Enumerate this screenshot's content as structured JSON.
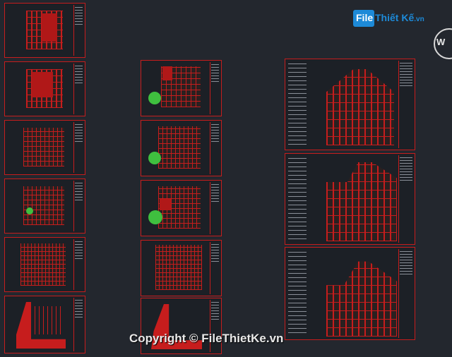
{
  "logo": {
    "part1": "File",
    "part2": "Thiết Kế",
    "suffix": ".vn"
  },
  "compass_letter": "W",
  "copyright": "Copyright © FileThietKe.vn",
  "colors": {
    "background": "#23272e",
    "frame": "#c61d1d",
    "accent": "#1d8ad8",
    "tree": "#3fbf3f"
  },
  "columns": [
    {
      "name": "floor-plans-left",
      "sheet_count": 6
    },
    {
      "name": "floor-plans-middle",
      "sheet_count": 6
    },
    {
      "name": "elevations-right",
      "sheet_count": 3
    }
  ]
}
